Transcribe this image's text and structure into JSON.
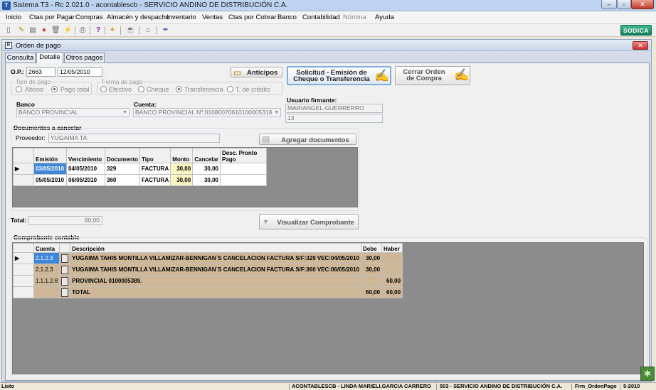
{
  "app": {
    "title": "Sistema T3 - Rc 2.021.0 - acontablescb - SERVICIO ANDINO DE DISTRIBUCIÓN C.A.",
    "logo": "SODICA"
  },
  "menu": [
    "Inicio",
    "Ctas por Pagar",
    "Compras",
    "Almacén y despacho",
    "Inventario",
    "Ventas",
    "Ctas por Cobrar",
    "Banco",
    "Contabilidad",
    "Nómina",
    "Ayuda"
  ],
  "toolbar_icons": [
    "new-icon",
    "edit-icon",
    "save-icon",
    "record-icon",
    "delete-icon",
    "flash-icon",
    "print-icon",
    "help-icon",
    "broom-icon",
    "cup-icon",
    "bank-icon",
    "pen-icon"
  ],
  "window": {
    "title": "Orden de pago"
  },
  "tabs": [
    "Consulta",
    "Detalle",
    "Otros pagos"
  ],
  "form": {
    "op_label": "O.P.:",
    "op_number": "2663",
    "op_date": "12/05/2010",
    "anticipos_label": "Anticipos",
    "solicitud_label_1": "Solicitud - Emisión de",
    "solicitud_label_2": "Cheque o Transferencia",
    "cerrar_label_1": "Cerrar Orden",
    "cerrar_label_2": "de Compra",
    "tipo_pago_label": "Tipo de pago",
    "tipo_pago_options": [
      "Abono",
      "Pago total"
    ],
    "forma_pago_label": "Forma de pago",
    "forma_pago_options": [
      "Efectivo",
      "Cheque",
      "Transferencia",
      "T. de crédito"
    ],
    "usuario_label": "Usuario firmante:",
    "usuario_name": "MARIANGEL.GUERRERRO",
    "usuario_code": "13",
    "banco_label": "Banco",
    "banco_value": "BANCO PROVINCIAL",
    "cuenta_label": "Cuenta:",
    "cuenta_value": "BANCO PROVINCIAL Nº:01080070610100005318",
    "docs_label": "Documentos a cancelar",
    "proveedor_label": "Proveedor:",
    "proveedor_value": "YUGAIMA TA",
    "agregar_label": "Agregar documentos",
    "total_label": "Total:",
    "total_value": "60,00",
    "visualizar_label": "Visualizar Comprobante",
    "comprobante_label": "Comprobante contable"
  },
  "docs_table": {
    "headers": [
      "Emisión",
      "Vencimiento",
      "Documento",
      "Tipo",
      "Monto",
      "Cancelar",
      "Desc. Pronto Pago"
    ],
    "rows": [
      [
        "03/05/2010",
        "04/05/2010",
        "329",
        "FACTURA",
        "30,00",
        "30,00",
        ""
      ],
      [
        "05/05/2010",
        "06/05/2010",
        "360",
        "FACTURA",
        "30,00",
        "30,00",
        ""
      ]
    ]
  },
  "comprobante_table": {
    "headers": [
      "Cuenta",
      "",
      "Descripción",
      "Debe",
      "Haber"
    ],
    "rows": [
      [
        "2.1.2.3",
        "",
        "YUGAIMA TAHIS MONTILLA VILLAMIZAR-BENNIGAN`S CANCELACION FACTURA S/F:329 VEC:04/05/2010",
        "30,00",
        ""
      ],
      [
        "2.1.2.3",
        "",
        "YUGAIMA TAHIS MONTILLA VILLAMIZAR-BENNIGAN`S CANCELACION FACTURA S/F:360 VEC:06/05/2010",
        "30,00",
        ""
      ],
      [
        "1.1.1.2.8",
        "",
        "PROVINCIAL 0100005389.",
        "",
        "60,00"
      ],
      [
        "",
        "",
        "TOTAL",
        "60,00",
        "60,00"
      ]
    ]
  },
  "status": {
    "left": "Listo",
    "user": "ACONTABLESCB - LINDA MARIELI,GARCIA CARRERO",
    "company": "503 - SERVICIO ANDINO DE DISTRIBUCIÓN C.A.",
    "form": "Frm_OrdenPago",
    "period": "5-2010"
  }
}
